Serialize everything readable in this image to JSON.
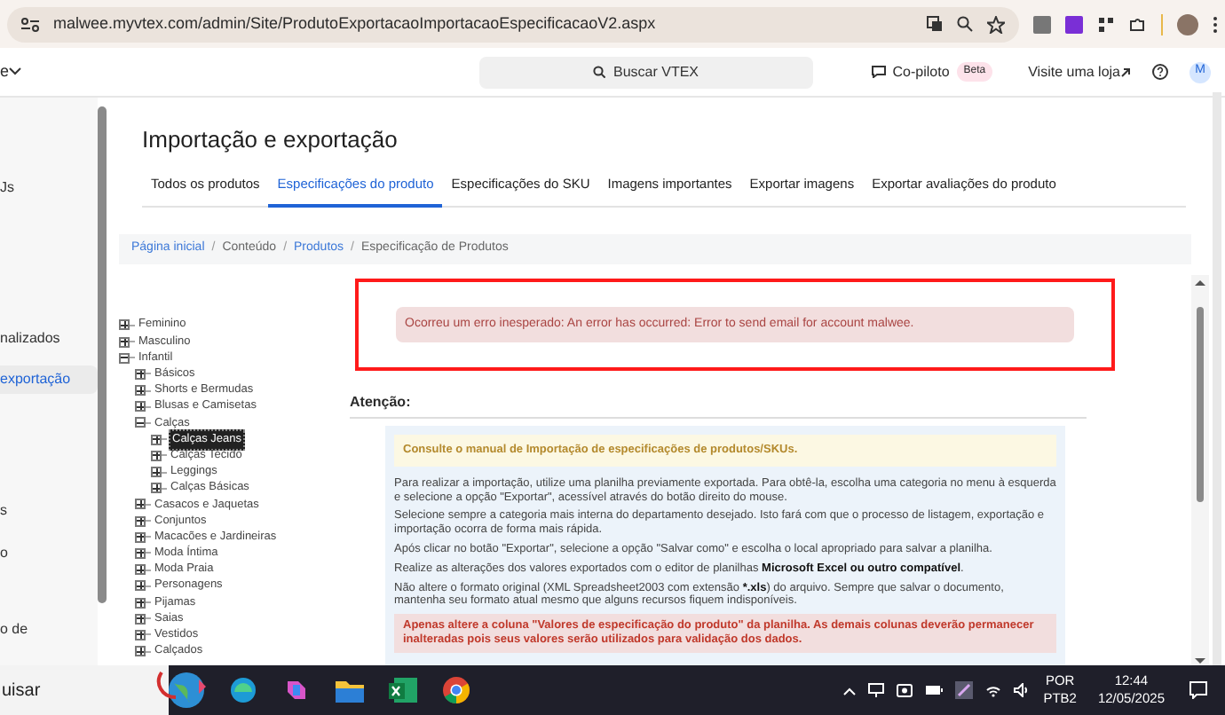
{
  "browser": {
    "url": "malwee.myvtex.com/admin/Site/ProdutoExportacaoImportacaoEspecificacaoV2.aspx"
  },
  "header": {
    "menu_fragment": "e",
    "search_placeholder": "Buscar VTEX",
    "copilot": "Co-piloto",
    "beta": "Beta",
    "visit_store": "Visite uma loja",
    "avatar": "M"
  },
  "sidebar": {
    "items": [
      {
        "label": "Js",
        "selected": false
      },
      {
        "label": "nalizados",
        "selected": false
      },
      {
        "label": "exportação",
        "selected": true
      },
      {
        "label": "s",
        "selected": false
      },
      {
        "label": "o",
        "selected": false
      },
      {
        "label": "o de",
        "selected": false
      }
    ]
  },
  "title": "Importação e exportação",
  "tabs": [
    {
      "label": "Todos os produtos",
      "selected": false
    },
    {
      "label": "Especificações do produto",
      "selected": true
    },
    {
      "label": "Especificações do SKU",
      "selected": false
    },
    {
      "label": "Imagens importantes",
      "selected": false
    },
    {
      "label": "Exportar imagens",
      "selected": false
    },
    {
      "label": "Exportar avaliações do produto",
      "selected": false
    }
  ],
  "breadcrumb": {
    "separator": "/",
    "items": [
      {
        "label": "Página inicial",
        "kind": "link"
      },
      {
        "label": "Conteúdo",
        "kind": "text"
      },
      {
        "label": "Produtos",
        "kind": "link"
      },
      {
        "label": "Especificação de Produtos",
        "kind": "text"
      }
    ]
  },
  "tree": [
    {
      "label": "Feminino",
      "expanded": false,
      "selected": false
    },
    {
      "label": "Masculino",
      "expanded": false,
      "selected": false
    },
    {
      "label": "Infantil",
      "expanded": true,
      "selected": false,
      "children": [
        {
          "label": "Básicos",
          "expanded": false,
          "selected": false
        },
        {
          "label": "Shorts e Bermudas",
          "expanded": false,
          "selected": false
        },
        {
          "label": "Blusas e Camisetas",
          "expanded": false,
          "selected": false
        },
        {
          "label": "Calças",
          "expanded": true,
          "selected": false,
          "children": [
            {
              "label": "Calças Jeans",
              "expanded": false,
              "selected": true
            },
            {
              "label": "Calças Tecido",
              "expanded": false,
              "selected": false
            },
            {
              "label": "Leggings",
              "expanded": false,
              "selected": false
            },
            {
              "label": "Calças Básicas",
              "expanded": false,
              "selected": false
            }
          ]
        },
        {
          "label": "Casacos e Jaquetas",
          "expanded": false,
          "selected": false
        },
        {
          "label": "Conjuntos",
          "expanded": false,
          "selected": false
        },
        {
          "label": "Macacões e Jardineiras",
          "expanded": false,
          "selected": false
        },
        {
          "label": "Moda Íntima",
          "expanded": false,
          "selected": false
        },
        {
          "label": "Moda Praia",
          "expanded": false,
          "selected": false
        },
        {
          "label": "Personagens",
          "expanded": false,
          "selected": false
        },
        {
          "label": "Pijamas",
          "expanded": false,
          "selected": false
        },
        {
          "label": "Saias",
          "expanded": false,
          "selected": false
        },
        {
          "label": "Vestidos",
          "expanded": false,
          "selected": false
        },
        {
          "label": "Calçados",
          "expanded": false,
          "selected": false
        }
      ]
    }
  ],
  "error_message": "Ocorreu um erro inesperado: An error has occurred: Error to send email for account malwee.",
  "attention": {
    "heading": "Atenção:",
    "notice": "Consulte o manual de Importação de especificações de produtos/SKUs.",
    "paragraphs": [
      [
        {
          "text": "Para realizar a importação, utilize uma planilha previamente exportada. Para obtê-la, escolha uma categoria no menu à esquerda e selecione a opção \"Exportar\", acessível através do botão direito do mouse.",
          "bold": false
        }
      ],
      [
        {
          "text": "Selecione sempre a categoria mais interna do departamento desejado. Isto fará com que o processo de listagem, exportação e importação ocorra de forma mais rápida.",
          "bold": false
        }
      ],
      [
        {
          "text": "Após clicar no botão \"Exportar\", selecione a opção \"Salvar como\" e escolha o local apropriado para salvar a planilha.",
          "bold": false
        }
      ],
      [
        {
          "text": "Realize as alterações dos valores exportados com o editor de planilhas ",
          "bold": false
        },
        {
          "text": "Microsoft Excel ou outro compatível",
          "bold": true
        },
        {
          "text": ".",
          "bold": false
        }
      ],
      [
        {
          "text": "Não altere o formato original (XML Spreadsheet2003 com extensão ",
          "bold": false
        },
        {
          "text": "*.xls",
          "bold": true
        },
        {
          "text": ") do arquivo. Sempre que salvar o documento, mantenha seu formato atual mesmo que alguns recursos fiquem indisponíveis.",
          "bold": false
        }
      ]
    ],
    "warning": "Apenas altere a coluna \"Valores de especificação do produto\" da planilha. As demais colunas deverão permanecer inalteradas pois seus valores serão utilizados para validação dos dados."
  },
  "taskbar": {
    "search_fragment": "uisar",
    "language": "POR",
    "layout": "PTB2",
    "time": "12:44",
    "date": "12/05/2025"
  }
}
